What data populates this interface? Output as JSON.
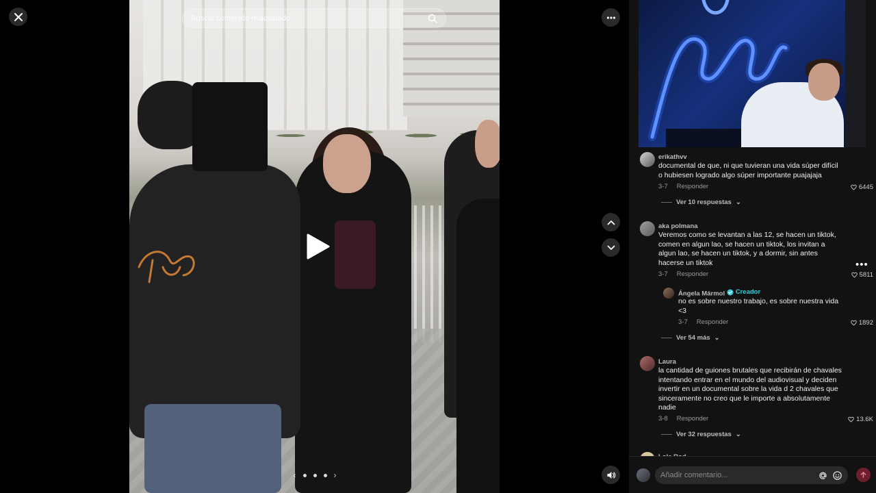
{
  "video": {
    "search_placeholder": "Buscar contenido relacionado"
  },
  "comments": [
    {
      "user": "erikathvv",
      "text": "documental de que, ni que tuvieran una vida súper difícil o hubiesen logrado algo súper importante puajajaja",
      "date": "3-7",
      "reply_label": "Responder",
      "likes": "6445",
      "view_replies": "Ver 10 respuestas"
    },
    {
      "user": "aka polmana",
      "text": "Veremos como se levantan a las 12, se hacen un tiktok, comen en algun lao, se hacen un tiktok, los invitan a algun lao, se hacen un tiktok, y a dormir, sin antes hacerse un tiktok",
      "date": "3-7",
      "reply_label": "Responder",
      "likes": "5811",
      "reply": {
        "user": "Ángela Mármol",
        "badge": "Creador",
        "text": "no es sobre nuestro trabajo, es sobre nuestra vida <3",
        "date": "3-7",
        "reply_label": "Responder",
        "likes": "1892"
      },
      "view_replies": "Ver 54 más"
    },
    {
      "user": "Laura",
      "text": "la cantidad de guiones brutales que recibirán de chavales intentando entrar en el mundo del audiovisual y deciden invertir en un documental sobre la vida d 2 chavales que sinceramente no creo que le importe a absolutamente nadie",
      "date": "3-8",
      "reply_label": "Responder",
      "likes": "13.6K",
      "view_replies": "Ver 32 respuestas"
    }
  ],
  "peek_user": "Lola Rod",
  "comment_input": {
    "placeholder": "Añadir comentario..."
  },
  "icons": {
    "close": "close-icon",
    "more": "more-horizontal-icon",
    "up": "chevron-up-icon",
    "down": "chevron-down-icon",
    "volume": "volume-icon",
    "heart": "heart-icon",
    "mention": "at-icon",
    "emoji": "emoji-icon",
    "send": "arrow-up-icon"
  },
  "colors": {
    "background": "#000000",
    "panel": "#121212",
    "creator_accent": "#38c9d6",
    "send_button": "#6e1e2d"
  }
}
